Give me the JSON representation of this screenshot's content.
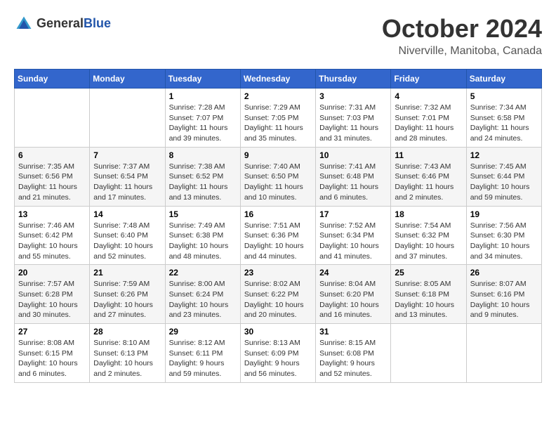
{
  "header": {
    "logo": {
      "general": "General",
      "blue": "Blue"
    },
    "title": "October 2024",
    "location": "Niverville, Manitoba, Canada"
  },
  "calendar": {
    "days_of_week": [
      "Sunday",
      "Monday",
      "Tuesday",
      "Wednesday",
      "Thursday",
      "Friday",
      "Saturday"
    ],
    "weeks": [
      [
        {
          "day": "",
          "info": ""
        },
        {
          "day": "",
          "info": ""
        },
        {
          "day": "1",
          "info": "Sunrise: 7:28 AM\nSunset: 7:07 PM\nDaylight: 11 hours and 39 minutes."
        },
        {
          "day": "2",
          "info": "Sunrise: 7:29 AM\nSunset: 7:05 PM\nDaylight: 11 hours and 35 minutes."
        },
        {
          "day": "3",
          "info": "Sunrise: 7:31 AM\nSunset: 7:03 PM\nDaylight: 11 hours and 31 minutes."
        },
        {
          "day": "4",
          "info": "Sunrise: 7:32 AM\nSunset: 7:01 PM\nDaylight: 11 hours and 28 minutes."
        },
        {
          "day": "5",
          "info": "Sunrise: 7:34 AM\nSunset: 6:58 PM\nDaylight: 11 hours and 24 minutes."
        }
      ],
      [
        {
          "day": "6",
          "info": "Sunrise: 7:35 AM\nSunset: 6:56 PM\nDaylight: 11 hours and 21 minutes."
        },
        {
          "day": "7",
          "info": "Sunrise: 7:37 AM\nSunset: 6:54 PM\nDaylight: 11 hours and 17 minutes."
        },
        {
          "day": "8",
          "info": "Sunrise: 7:38 AM\nSunset: 6:52 PM\nDaylight: 11 hours and 13 minutes."
        },
        {
          "day": "9",
          "info": "Sunrise: 7:40 AM\nSunset: 6:50 PM\nDaylight: 11 hours and 10 minutes."
        },
        {
          "day": "10",
          "info": "Sunrise: 7:41 AM\nSunset: 6:48 PM\nDaylight: 11 hours and 6 minutes."
        },
        {
          "day": "11",
          "info": "Sunrise: 7:43 AM\nSunset: 6:46 PM\nDaylight: 11 hours and 2 minutes."
        },
        {
          "day": "12",
          "info": "Sunrise: 7:45 AM\nSunset: 6:44 PM\nDaylight: 10 hours and 59 minutes."
        }
      ],
      [
        {
          "day": "13",
          "info": "Sunrise: 7:46 AM\nSunset: 6:42 PM\nDaylight: 10 hours and 55 minutes."
        },
        {
          "day": "14",
          "info": "Sunrise: 7:48 AM\nSunset: 6:40 PM\nDaylight: 10 hours and 52 minutes."
        },
        {
          "day": "15",
          "info": "Sunrise: 7:49 AM\nSunset: 6:38 PM\nDaylight: 10 hours and 48 minutes."
        },
        {
          "day": "16",
          "info": "Sunrise: 7:51 AM\nSunset: 6:36 PM\nDaylight: 10 hours and 44 minutes."
        },
        {
          "day": "17",
          "info": "Sunrise: 7:52 AM\nSunset: 6:34 PM\nDaylight: 10 hours and 41 minutes."
        },
        {
          "day": "18",
          "info": "Sunrise: 7:54 AM\nSunset: 6:32 PM\nDaylight: 10 hours and 37 minutes."
        },
        {
          "day": "19",
          "info": "Sunrise: 7:56 AM\nSunset: 6:30 PM\nDaylight: 10 hours and 34 minutes."
        }
      ],
      [
        {
          "day": "20",
          "info": "Sunrise: 7:57 AM\nSunset: 6:28 PM\nDaylight: 10 hours and 30 minutes."
        },
        {
          "day": "21",
          "info": "Sunrise: 7:59 AM\nSunset: 6:26 PM\nDaylight: 10 hours and 27 minutes."
        },
        {
          "day": "22",
          "info": "Sunrise: 8:00 AM\nSunset: 6:24 PM\nDaylight: 10 hours and 23 minutes."
        },
        {
          "day": "23",
          "info": "Sunrise: 8:02 AM\nSunset: 6:22 PM\nDaylight: 10 hours and 20 minutes."
        },
        {
          "day": "24",
          "info": "Sunrise: 8:04 AM\nSunset: 6:20 PM\nDaylight: 10 hours and 16 minutes."
        },
        {
          "day": "25",
          "info": "Sunrise: 8:05 AM\nSunset: 6:18 PM\nDaylight: 10 hours and 13 minutes."
        },
        {
          "day": "26",
          "info": "Sunrise: 8:07 AM\nSunset: 6:16 PM\nDaylight: 10 hours and 9 minutes."
        }
      ],
      [
        {
          "day": "27",
          "info": "Sunrise: 8:08 AM\nSunset: 6:15 PM\nDaylight: 10 hours and 6 minutes."
        },
        {
          "day": "28",
          "info": "Sunrise: 8:10 AM\nSunset: 6:13 PM\nDaylight: 10 hours and 2 minutes."
        },
        {
          "day": "29",
          "info": "Sunrise: 8:12 AM\nSunset: 6:11 PM\nDaylight: 9 hours and 59 minutes."
        },
        {
          "day": "30",
          "info": "Sunrise: 8:13 AM\nSunset: 6:09 PM\nDaylight: 9 hours and 56 minutes."
        },
        {
          "day": "31",
          "info": "Sunrise: 8:15 AM\nSunset: 6:08 PM\nDaylight: 9 hours and 52 minutes."
        },
        {
          "day": "",
          "info": ""
        },
        {
          "day": "",
          "info": ""
        }
      ]
    ]
  }
}
